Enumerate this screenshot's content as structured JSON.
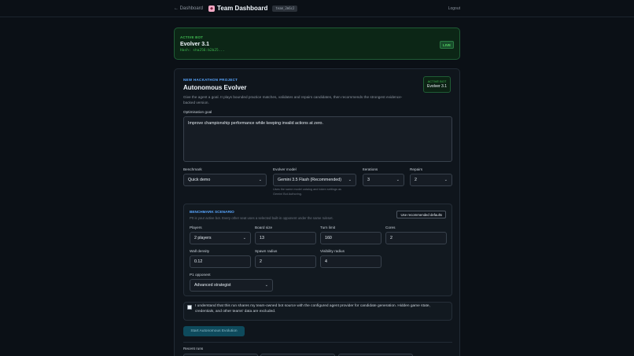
{
  "header": {
    "back_label": "← Dashboard",
    "title": "Team Dashboard",
    "team_id": "team_2m6c2",
    "logout_label": "Logout"
  },
  "active_bot": {
    "label": "ACTIVE BOT",
    "name": "Evolver 3.1",
    "hash": "Hash: sha256:b2b25...",
    "status": "LIVE"
  },
  "project": {
    "kicker": "NEW HACKATHON PROJECT",
    "title": "Autonomous Evolver",
    "description": "Give the agent a goal. It plays bounded practice matches, validates and repairs candidates, then recommends the strongest evidence-backed version.",
    "badge_label": "ACTIVE BOT",
    "badge_name": "Evolver 3.1",
    "goal_label": "Optimisation goal",
    "goal_value": "Improve championship performance while keeping invalid actions at zero."
  },
  "controls": {
    "benchmark_label": "Benchmark",
    "benchmark_value": "Quick demo",
    "model_label": "Evolver model",
    "model_value": "Gemini 3.5 Flash (Recommended)",
    "model_help": "Uses the same model catalog and token settings as Gemini Bot Authoring.",
    "iterations_label": "Iterations",
    "iterations_value": "3",
    "repairs_label": "Repairs",
    "repairs_value": "2"
  },
  "scenario": {
    "title": "BENCHMARK SCENARIO",
    "description": "P0 is your active bot. Every other seat uses a selected built-in opponent under the same ruleset.",
    "defaults_button": "Use recommended defaults",
    "players_label": "Players",
    "players_value": "2 players",
    "board_label": "Board size",
    "board_value": "13",
    "turn_label": "Turn limit",
    "turn_value": "160",
    "cores_label": "Cores",
    "cores_value": "2",
    "wall_label": "Wall density",
    "wall_value": "0.12",
    "spawn_label": "Spawn radius",
    "spawn_value": "2",
    "visibility_label": "Visibility radius",
    "visibility_value": "4",
    "opponent_label": "P1 opponent",
    "opponent_value": "Advanced strategist"
  },
  "consent": {
    "text": "I understand that this run shares my team-owned bot source with the configured agent provider for candidate generation. Hidden game state, credentials, and other teams' data are excluded."
  },
  "actions": {
    "start_label": "Start Autonomous Evolution",
    "recent_label": "Recent runs"
  },
  "icons": {
    "logo": "gem-icon",
    "chevron": "chevron-down-icon"
  }
}
